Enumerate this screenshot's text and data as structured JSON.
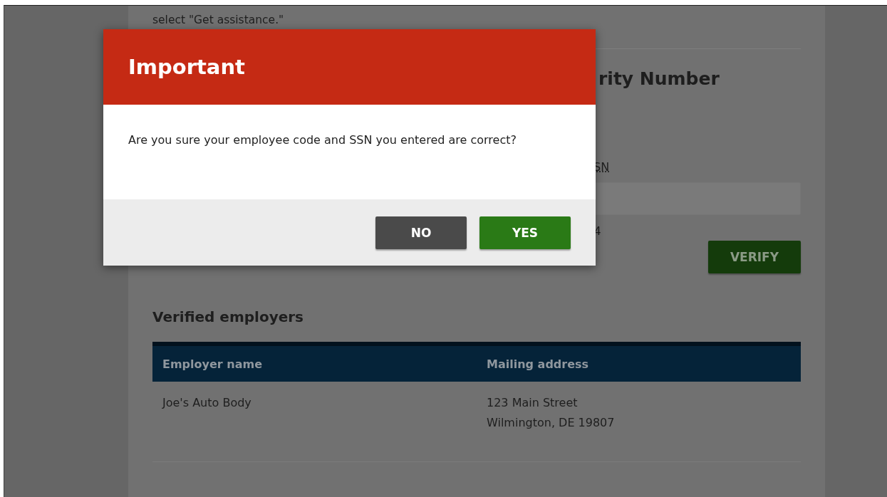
{
  "page": {
    "intro_text": "select \"Get assistance.\"",
    "section_heading": "rity Number",
    "ssn_label": "SN",
    "ssn_hint": "4",
    "verify_button": "VERIFY"
  },
  "employers": {
    "heading": "Verified employers",
    "columns": [
      "Employer name",
      "Mailing address"
    ],
    "rows": [
      {
        "name": "Joe's Auto Body",
        "address_lines": [
          "123 Main Street",
          "Wilmington, DE 19807"
        ]
      }
    ]
  },
  "dialog": {
    "title": "Important",
    "message": "Are you sure your employee code and SSN you entered are correct?",
    "buttons": [
      {
        "label": "NO",
        "kind": "secondary"
      },
      {
        "label": "YES",
        "kind": "primary"
      }
    ]
  }
}
